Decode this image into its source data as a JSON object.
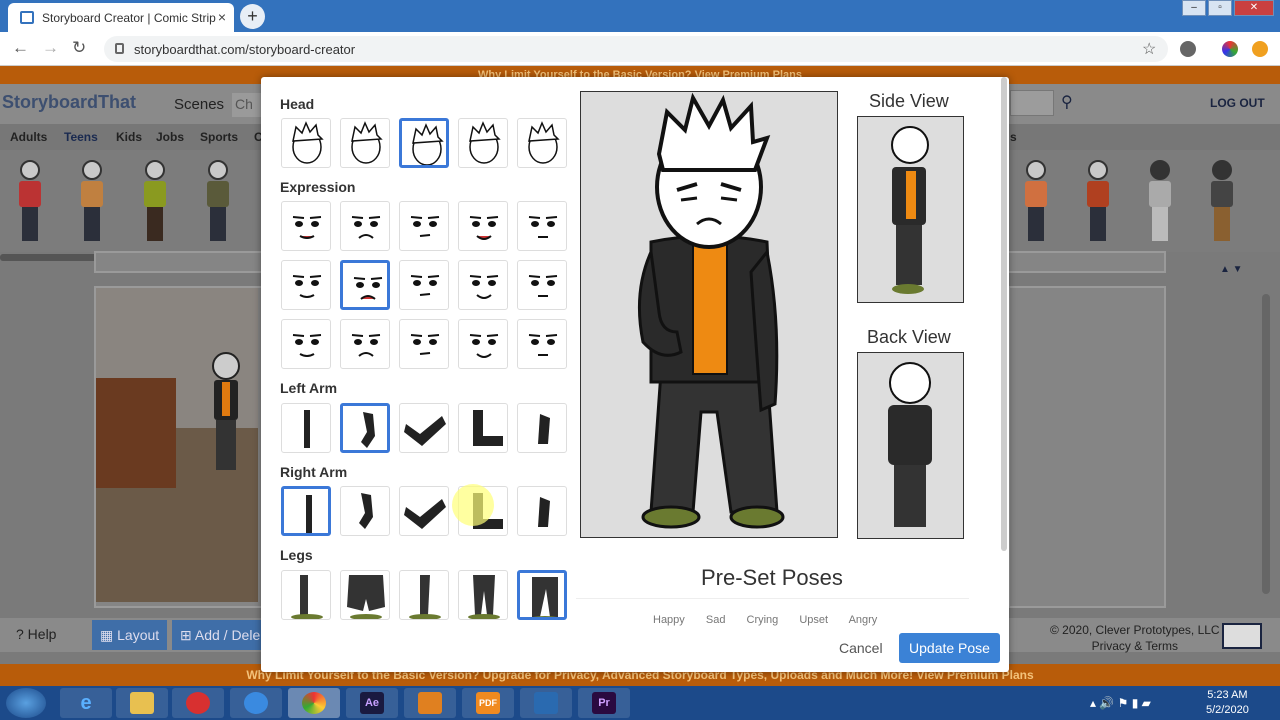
{
  "browser": {
    "tab_title": "Storyboard Creator | Comic Strip",
    "tab_close": "×",
    "new_tab": "+",
    "url": "storyboardthat.com/storyboard-creator",
    "window_buttons": [
      "‒",
      "▫",
      "✕"
    ]
  },
  "site": {
    "top_banner": "Why Limit Yourself to the Basic Version?   View Premium Plans",
    "logo": "StoryboardThat",
    "scenes_tab": "Scenes",
    "characters_tab": "Ch",
    "logout": "LOG OUT",
    "categories": [
      "Adults",
      "Teens",
      "Kids",
      "Jobs",
      "Sports",
      "C"
    ],
    "active_category": "Teens",
    "category_tail": "s",
    "help": "? Help",
    "layout_btn": "Layout",
    "add_delete_btn": "Add / Dele",
    "copyright": "© 2020, Clever Prototypes, LLC",
    "privacy": "Privacy & Terms",
    "bottom_banner": "Why Limit Yourself to the Basic Version? Upgrade for Privacy, Advanced Storyboard Types, Uploads and Much More!   View Premium Plans",
    "colors": {
      "banner": "#b85c0a",
      "accent": "#3b78d8",
      "navy": "#1a2440"
    }
  },
  "modal": {
    "sections": {
      "head": "Head",
      "expression": "Expression",
      "left_arm": "Left Arm",
      "right_arm": "Right Arm",
      "legs": "Legs"
    },
    "side_view": "Side View",
    "back_view": "Back View",
    "preset_title": "Pre-Set Poses",
    "poses": [
      "Happy",
      "Sad",
      "Crying",
      "Upset",
      "Angry"
    ],
    "cancel": "Cancel",
    "update": "Update Pose",
    "selected": {
      "head": 3,
      "expression": 7,
      "left_arm": 2,
      "right_arm": 1,
      "legs": 5
    }
  },
  "taskbar": {
    "time": "5:23 AM",
    "date": "5/2/2020",
    "apps": [
      "ie-icon",
      "explorer-icon",
      "recorder-icon",
      "teamviewer-icon",
      "chrome-icon",
      "after-effects-icon",
      "media-player-icon",
      "pdf-icon",
      "capture-icon",
      "premiere-icon"
    ],
    "ae": "Ae",
    "pr": "Pr",
    "pdf": "PDF"
  }
}
